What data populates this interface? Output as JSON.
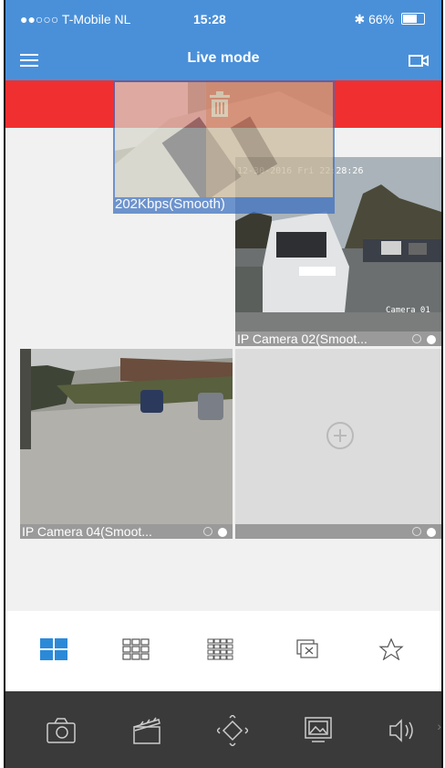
{
  "status_bar": {
    "carrier": "●●○○○ T-Mobile NL",
    "time": "15:28",
    "battery": "66%"
  },
  "nav": {
    "title": "Live mode"
  },
  "dragging_tile": {
    "label": "202Kbps(Smooth)"
  },
  "tiles": [
    {
      "label": "IP Camera 02(Smoot...",
      "timestamp": "12-30-2016 Fri 22:28:26",
      "overlay": "Camera 01"
    },
    {
      "label": "IP Camera 04(Smoot..."
    },
    {
      "label": ""
    }
  ],
  "layout_options": [
    "single-view",
    "4-view",
    "9-view",
    "16-view",
    "close-all",
    "favorites"
  ],
  "controls": [
    "snapshot",
    "record",
    "ptz",
    "image-settings",
    "audio"
  ],
  "colors": {
    "accent": "#4a90d9",
    "delete": "#f03030",
    "toolbar": "#3a3a3a"
  }
}
